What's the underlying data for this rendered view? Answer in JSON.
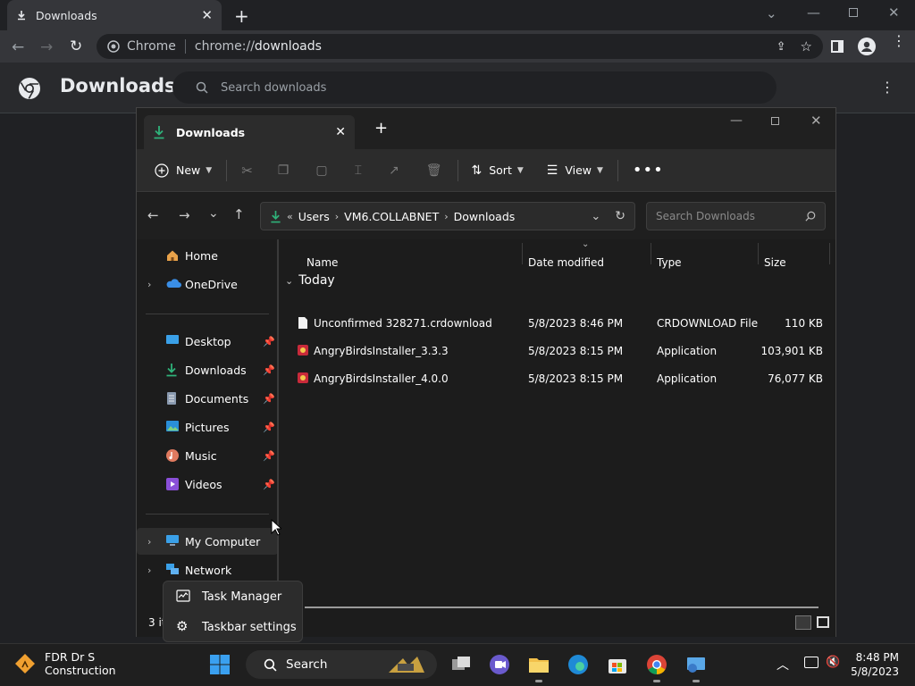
{
  "browser": {
    "tab_title": "Downloads",
    "omnibox_chip": "Chrome",
    "omnibox_url_scheme": "chrome://",
    "omnibox_url_host": "downloads"
  },
  "downloads_page": {
    "title": "Downloads",
    "search_placeholder": "Search downloads"
  },
  "explorer": {
    "tab_title": "Downloads",
    "commands": {
      "new_label": "New",
      "sort_label": "Sort",
      "view_label": "View"
    },
    "breadcrumb": [
      "Users",
      "VM6.COLLABNET",
      "Downloads"
    ],
    "search_placeholder": "Search Downloads",
    "nav": [
      {
        "label": "Home",
        "icon": "home-icon"
      },
      {
        "label": "OneDrive",
        "icon": "onedrive-cloud-icon"
      },
      {
        "label": "Desktop",
        "icon": "desktop-icon"
      },
      {
        "label": "Downloads",
        "icon": "download-arrow-icon"
      },
      {
        "label": "Documents",
        "icon": "documents-icon"
      },
      {
        "label": "Pictures",
        "icon": "pictures-icon"
      },
      {
        "label": "Music",
        "icon": "music-icon"
      },
      {
        "label": "Videos",
        "icon": "videos-icon"
      },
      {
        "label": "My Computer",
        "icon": "computer-icon"
      },
      {
        "label": "Network",
        "icon": "network-icon"
      }
    ],
    "columns": [
      "Name",
      "Date modified",
      "Type",
      "Size"
    ],
    "group_label": "Today",
    "files": [
      {
        "name": "Unconfirmed 328271.crdownload",
        "date": "5/8/2023 8:46 PM",
        "type": "CRDOWNLOAD File",
        "size": "110 KB",
        "icon": "blank-file-icon"
      },
      {
        "name": "AngryBirdsInstaller_3.3.3",
        "date": "5/8/2023 8:15 PM",
        "type": "Application",
        "size": "103,901 KB",
        "icon": "installer-app-icon"
      },
      {
        "name": "AngryBirdsInstaller_4.0.0",
        "date": "5/8/2023 8:15 PM",
        "type": "Application",
        "size": "76,077 KB",
        "icon": "installer-app-icon"
      }
    ],
    "status_text": "3 it"
  },
  "context_menu": {
    "items": [
      "Task Manager",
      "Taskbar settings"
    ]
  },
  "taskbar": {
    "weather_line1": "FDR Dr S",
    "weather_line2": "Construction",
    "search_label": "Search",
    "time": "8:48 PM",
    "date": "5/8/2023"
  },
  "colors": {
    "accent_green": "#2fb37a",
    "chrome_bg": "#202124",
    "explorer_bg": "#1c1c1c"
  }
}
